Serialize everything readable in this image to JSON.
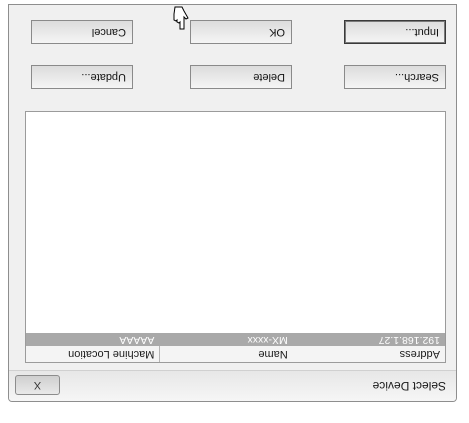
{
  "window": {
    "title": "Select Device",
    "close_label": "X"
  },
  "table": {
    "columns": [
      "Address",
      "Name",
      "Machine Location"
    ],
    "rows": [
      {
        "address": "192.168.1.27",
        "name": "MX-xxxx",
        "location": "AAAAA",
        "selected": true
      }
    ]
  },
  "buttons": {
    "search": "Search...",
    "delete": "Delete",
    "update": "Update...",
    "input": "Input...",
    "ok": "OK",
    "cancel": "Cancel"
  },
  "colors": {
    "selection": "#a9a9a9",
    "dialog_bg": "#f0f0f0"
  }
}
